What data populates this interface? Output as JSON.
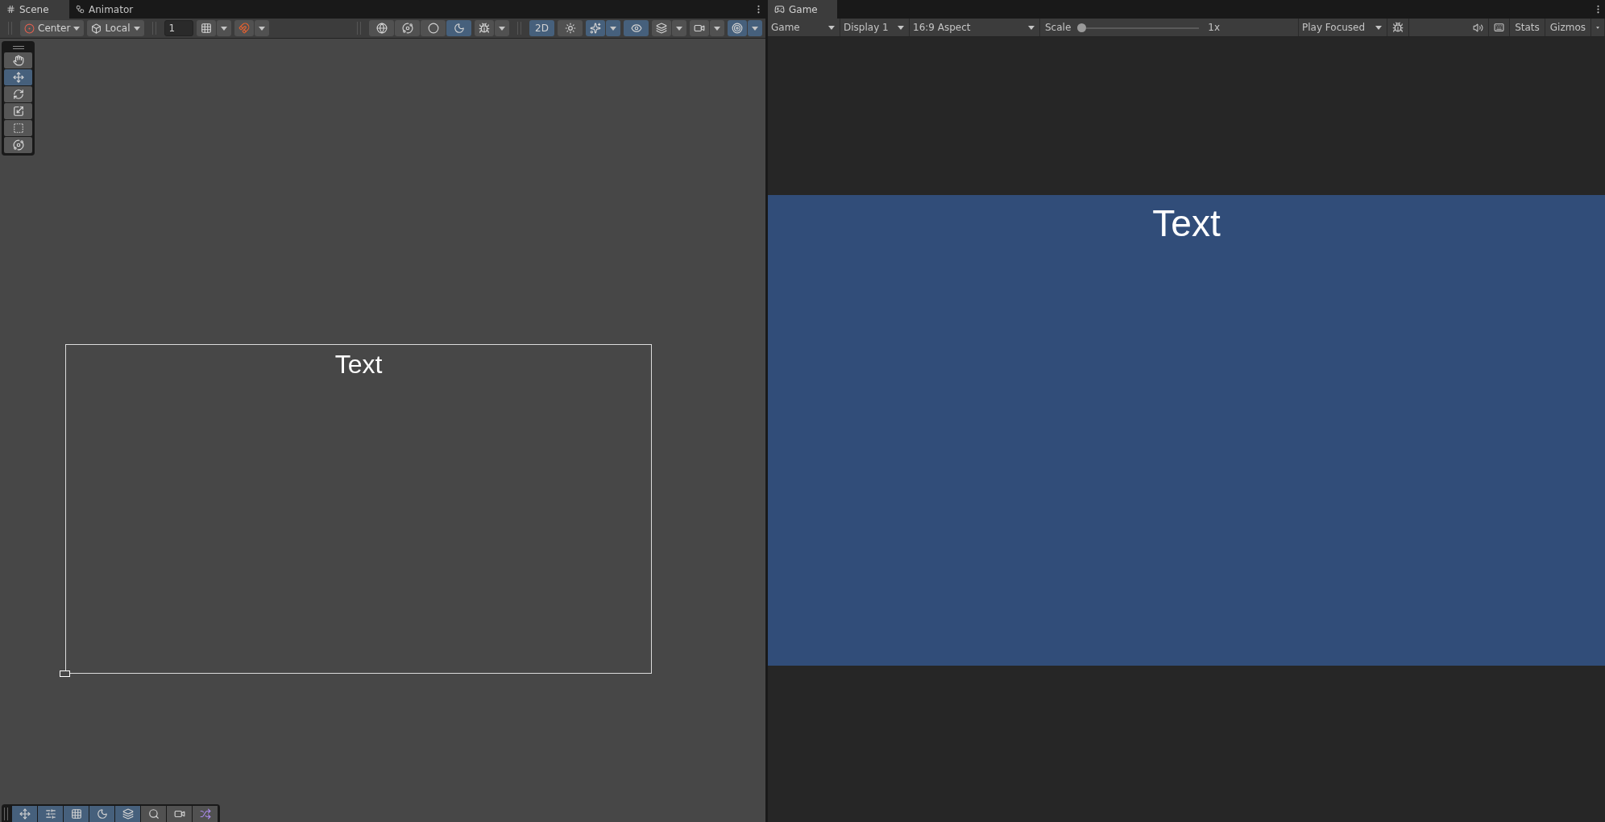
{
  "scene": {
    "tabs": [
      {
        "label": "Scene",
        "selected": true
      },
      {
        "label": "Animator",
        "selected": false
      }
    ],
    "toolbar": {
      "pivot": "Center",
      "space": "Local",
      "grid_step": "1",
      "grid_snap": {
        "selected": false
      },
      "increment_snap": {
        "selected": false
      },
      "shading": [
        {
          "selected": false
        },
        {
          "selected": false
        },
        {
          "selected": false
        },
        {
          "selected": true
        }
      ],
      "debug": {
        "selected": false
      },
      "mode_2d": {
        "label": "2D",
        "selected": true
      },
      "toggles": [
        {
          "selected": false
        },
        {
          "selected": true
        },
        {
          "selected": true
        },
        {
          "selected": false
        },
        {
          "selected": false
        },
        {
          "selected": true
        }
      ]
    },
    "tools": [
      {
        "selected": false
      },
      {
        "selected": true
      },
      {
        "selected": false
      },
      {
        "selected": false
      },
      {
        "selected": false
      },
      {
        "selected": false
      }
    ],
    "overlays": [
      {
        "selected": true
      },
      {
        "selected": true
      },
      {
        "selected": true
      },
      {
        "selected": true
      },
      {
        "selected": true
      },
      {
        "selected": false
      },
      {
        "selected": false
      },
      {
        "selected": false
      }
    ],
    "canvas_text": "Text"
  },
  "game": {
    "tab": "Game",
    "target": "Game",
    "display": "Display 1",
    "aspect": "16:9 Aspect",
    "scale_label": "Scale",
    "scale": {
      "level": 0
    },
    "scale_value": "1x",
    "play_mode": "Play Focused",
    "debug": {
      "selected": false
    },
    "mute": {
      "selected": false
    },
    "shortcuts": {
      "selected": false
    },
    "stats": "Stats",
    "gizmos": "Gizmos",
    "text": "Text"
  }
}
